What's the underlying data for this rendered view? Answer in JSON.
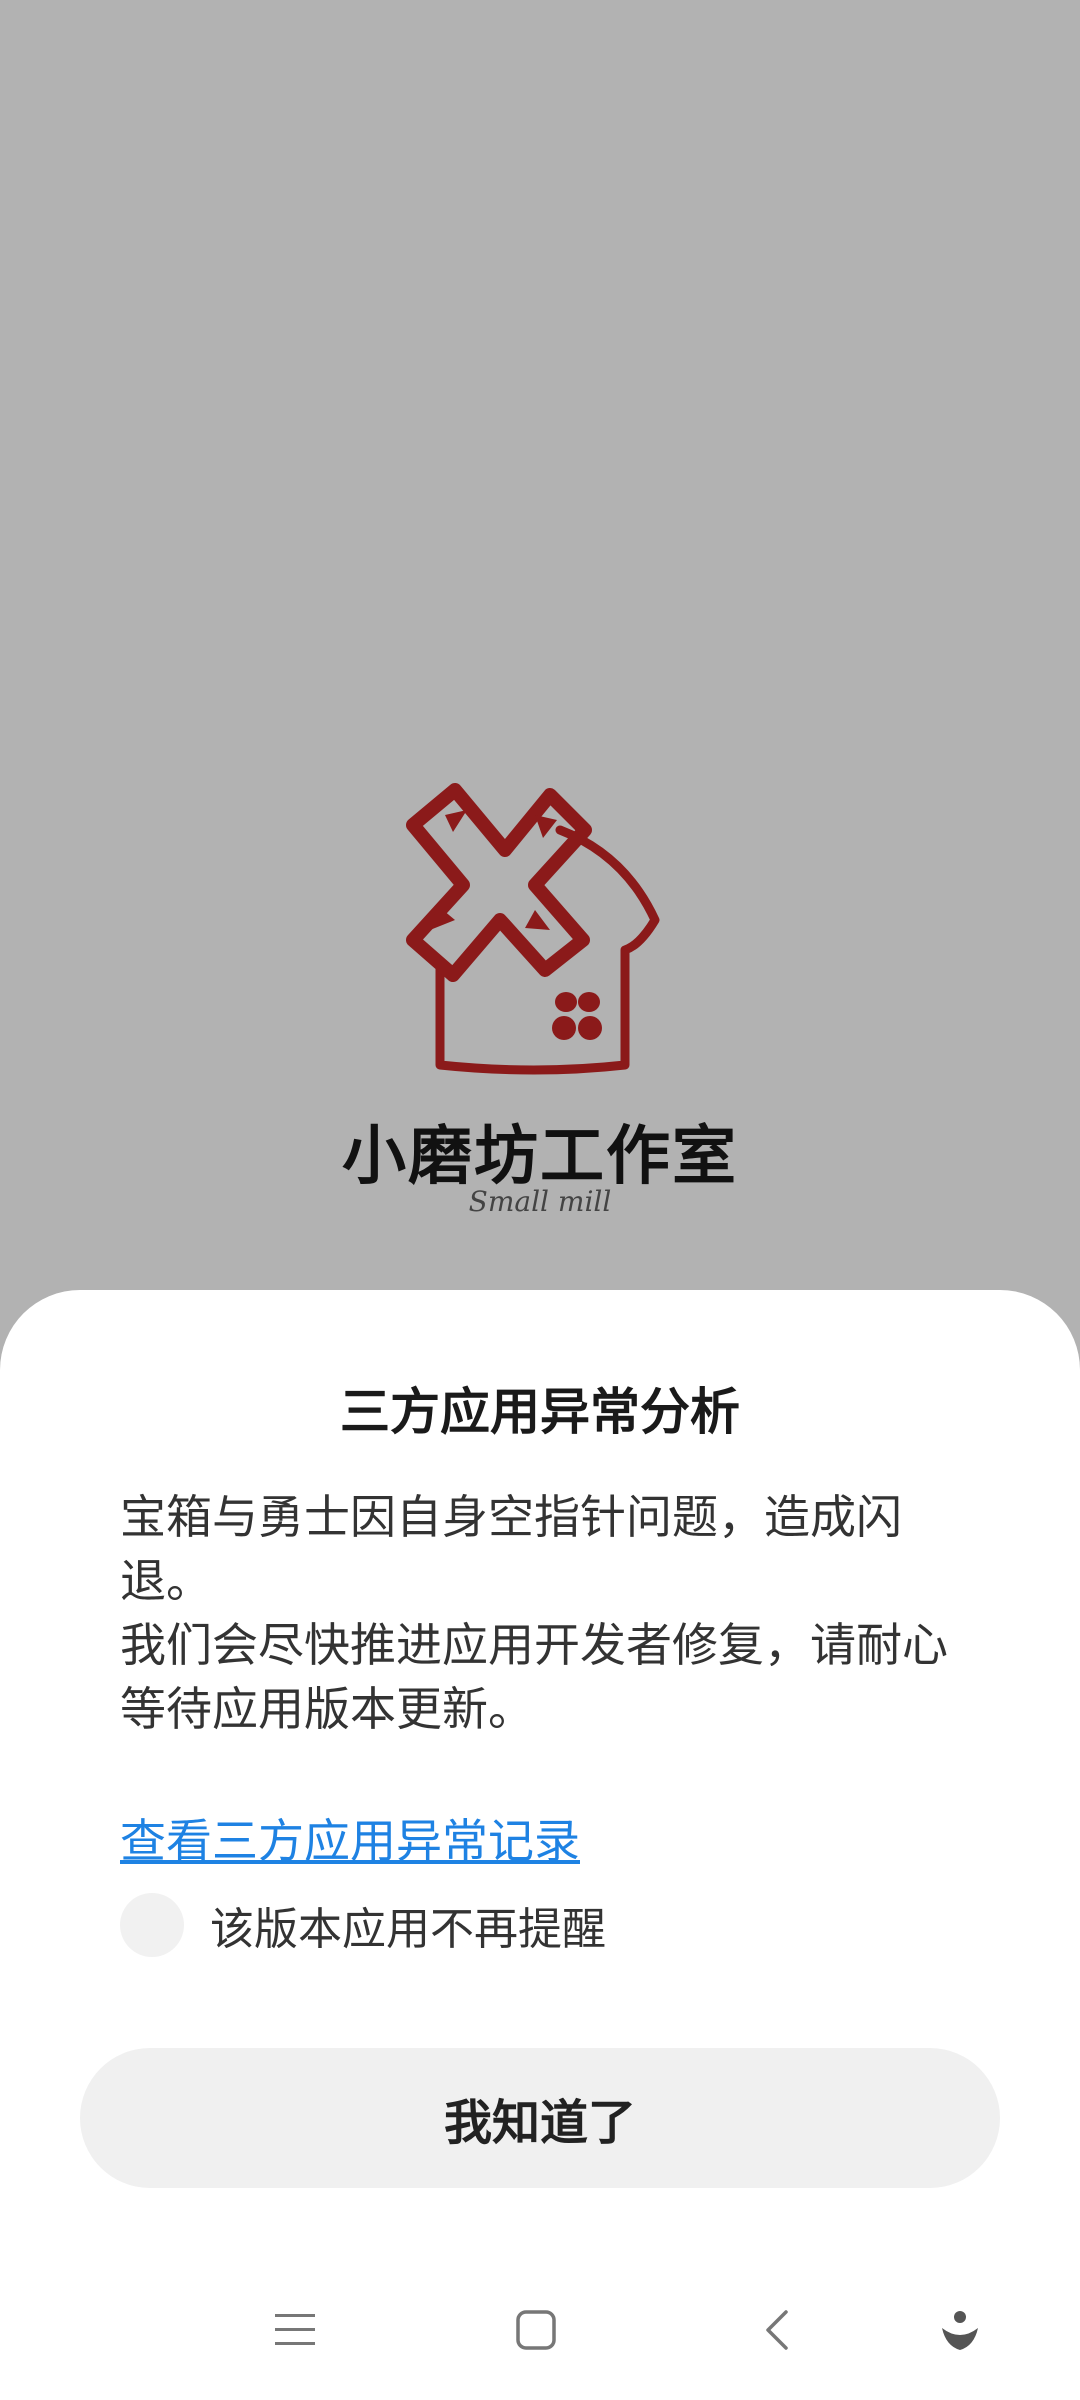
{
  "splash": {
    "brand_title": "小磨坊工作室",
    "brand_subtitle": "Small mill",
    "logo_color": "#8b1a1a"
  },
  "dialog": {
    "title": "三方应用异常分析",
    "message": "宝箱与勇士因自身空指针问题，造成闪退。\n我们会尽快推进应用开发者修复，请耐心等待应用版本更新。",
    "link_text": "查看三方应用异常记录",
    "checkbox_label": "该版本应用不再提醒",
    "checkbox_checked": false,
    "ok_button_label": "我知道了",
    "link_color": "#1e82e3"
  },
  "navbar": {
    "icons": [
      "menu-icon",
      "home-square-icon",
      "back-chevron-icon",
      "assistant-icon"
    ]
  }
}
